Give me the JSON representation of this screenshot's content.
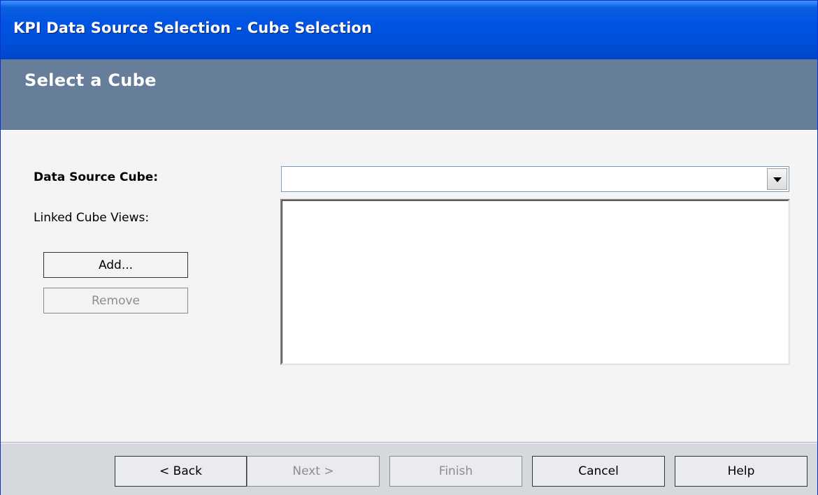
{
  "window": {
    "title": "KPI Data Source Selection - Cube Selection"
  },
  "header": {
    "title": "Select a Cube"
  },
  "form": {
    "data_source_cube_label": "Data Source Cube:",
    "data_source_cube_value": "",
    "linked_cube_views_label": "Linked Cube Views:",
    "linked_cube_views_items": [],
    "add_label": "Add...",
    "remove_label": "Remove"
  },
  "footer": {
    "back_label": "< Back",
    "next_label": "Next >",
    "finish_label": "Finish",
    "cancel_label": "Cancel",
    "help_label": "Help"
  },
  "icons": {
    "combo_dropdown": "chevron-down-icon"
  }
}
